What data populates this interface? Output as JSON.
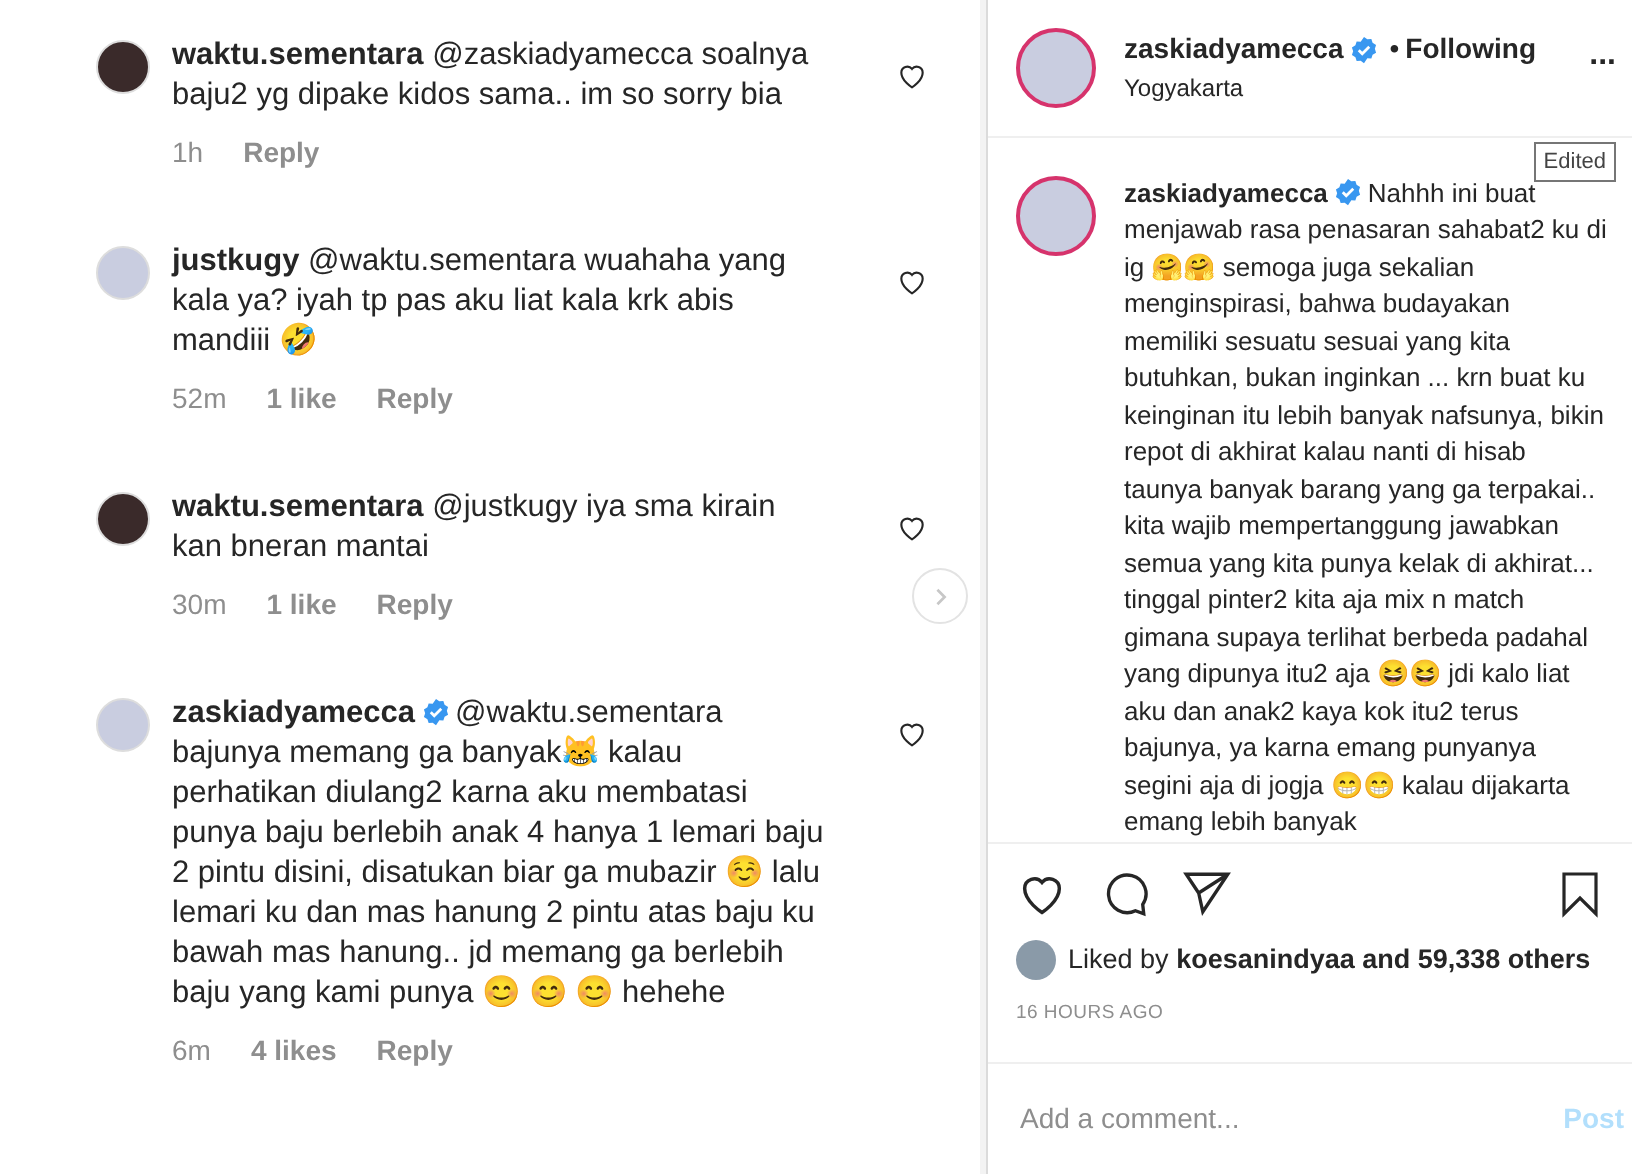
{
  "comments": [
    {
      "user": "waktu.sementara",
      "verified": false,
      "text": "@zaskiadyamecca soalnya baju2 yg dipake kidos sama.. im so sorry bia",
      "time": "1h",
      "reply": "Reply"
    },
    {
      "user": "justkugy",
      "verified": false,
      "text": "@waktu.sementara wuahaha yang kala ya? iyah tp pas aku liat kala krk abis mandiii 🤣",
      "time": "52m",
      "likes": "1 like",
      "reply": "Reply"
    },
    {
      "user": "waktu.sementara",
      "verified": false,
      "text": "@justkugy iya sma kirain kan bneran mantai",
      "time": "30m",
      "likes": "1 like",
      "reply": "Reply"
    },
    {
      "user": "zaskiadyamecca",
      "verified": true,
      "text": "@waktu.sementara bajunya memang ga banyak😹 kalau perhatikan diulang2 karna aku membatasi punya baju berlebih anak 4 hanya 1 lemari baju 2 pintu disini, disatukan biar ga mubazir ☺️ lalu lemari ku dan mas hanung 2 pintu atas baju ku bawah mas hanung.. jd memang ga berlebih baju yang kami punya 😊 😊 😊 hehehe",
      "time": "6m",
      "likes": "4 likes",
      "reply": "Reply"
    }
  ],
  "post": {
    "header": {
      "user": "zaskiadyamecca",
      "verified": true,
      "separator": "•",
      "follow": "Following",
      "location": "Yogyakarta",
      "more": "..."
    },
    "caption": {
      "user": "zaskiadyamecca",
      "verified": true,
      "text": "Nahhh ini buat menjawab rasa penasaran sahabat2 ku di ig 🤗🤗 semoga juga sekalian menginspirasi, bahwa budayakan memiliki sesuatu sesuai yang kita butuhkan, bukan inginkan ... krn buat ku keinginan itu lebih banyak nafsunya, bikin repot di akhirat kalau nanti di hisab taunya banyak barang yang ga terpakai.. kita wajib mempertanggung jawabkan semua yang kita punya kelak di akhirat... tinggal pinter2 kita aja mix n match gimana supaya terlihat berbeda padahal yang dipunya itu2 aja 😆😆 jdi kalo liat aku dan anak2 kaya kok itu2 terus bajunya, ya karna emang punyanya segini aja di jogja 😁😁 kalau dijakarta emang lebih banyak"
    },
    "tooltip": "Edited",
    "liked_by": {
      "prefix": "Liked by",
      "user": "koesanindyaa",
      "rest": "and 59,338 others"
    },
    "time": "16 HOURS AGO",
    "comment_field": {
      "placeholder": "Add a comment...",
      "button": "Post"
    }
  }
}
